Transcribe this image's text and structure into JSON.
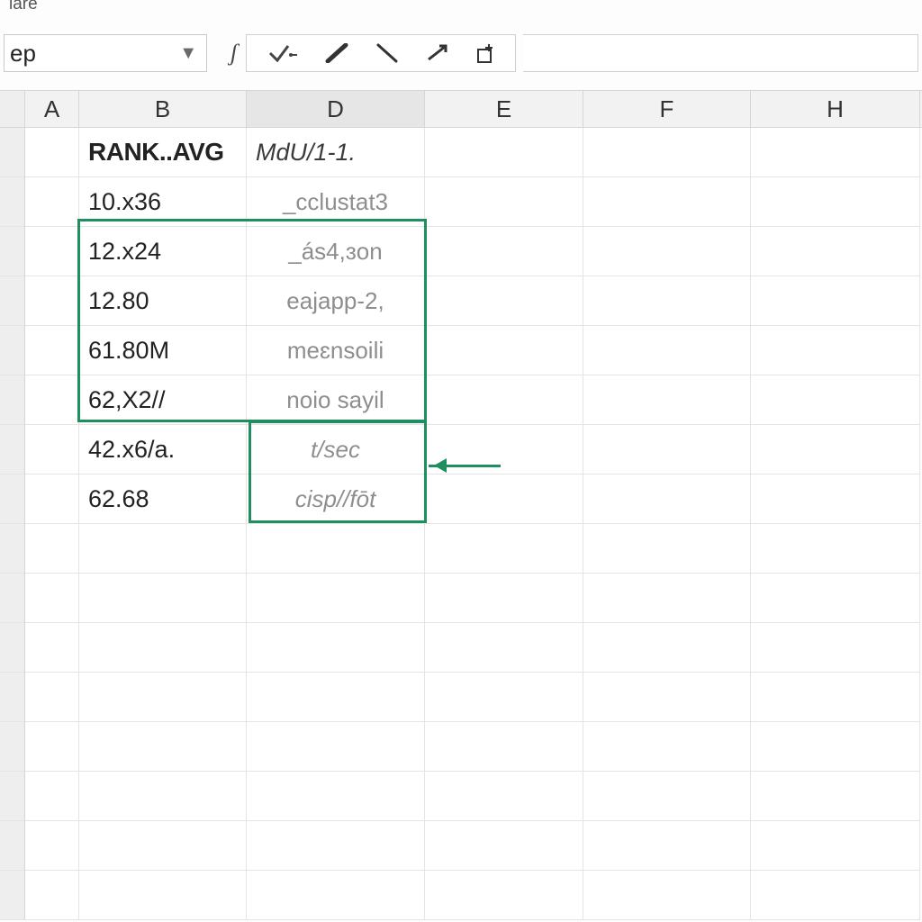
{
  "ribbon_fragment": "iare",
  "namebox": {
    "value": "ep"
  },
  "columns": [
    "A",
    "B",
    "D",
    "E",
    "F",
    "H"
  ],
  "selected_column": "D",
  "headers": {
    "B": "RANK..AVG",
    "D": "MdU/1-1."
  },
  "rows": [
    {
      "B": "10.x36",
      "D": "_cclustat3",
      "italic": false
    },
    {
      "B": "12.x24",
      "D": "_ás4,ɜon",
      "italic": false
    },
    {
      "B": "12.80",
      "D": "eajapp-2,",
      "italic": false
    },
    {
      "B": "61.80M",
      "D": "meɛnsoili",
      "italic": false
    },
    {
      "B": "62,X2//",
      "D": "noio sayil",
      "italic": false
    },
    {
      "B": "42.x6/a.",
      "D": "t/sec",
      "italic": true
    },
    {
      "B": "62.68",
      "D": "cisp//fōt",
      "italic": true
    }
  ],
  "colors": {
    "selection": "#1f8f5f",
    "grid_line": "#e4e4e4",
    "header_bg": "#f2f2f2"
  }
}
